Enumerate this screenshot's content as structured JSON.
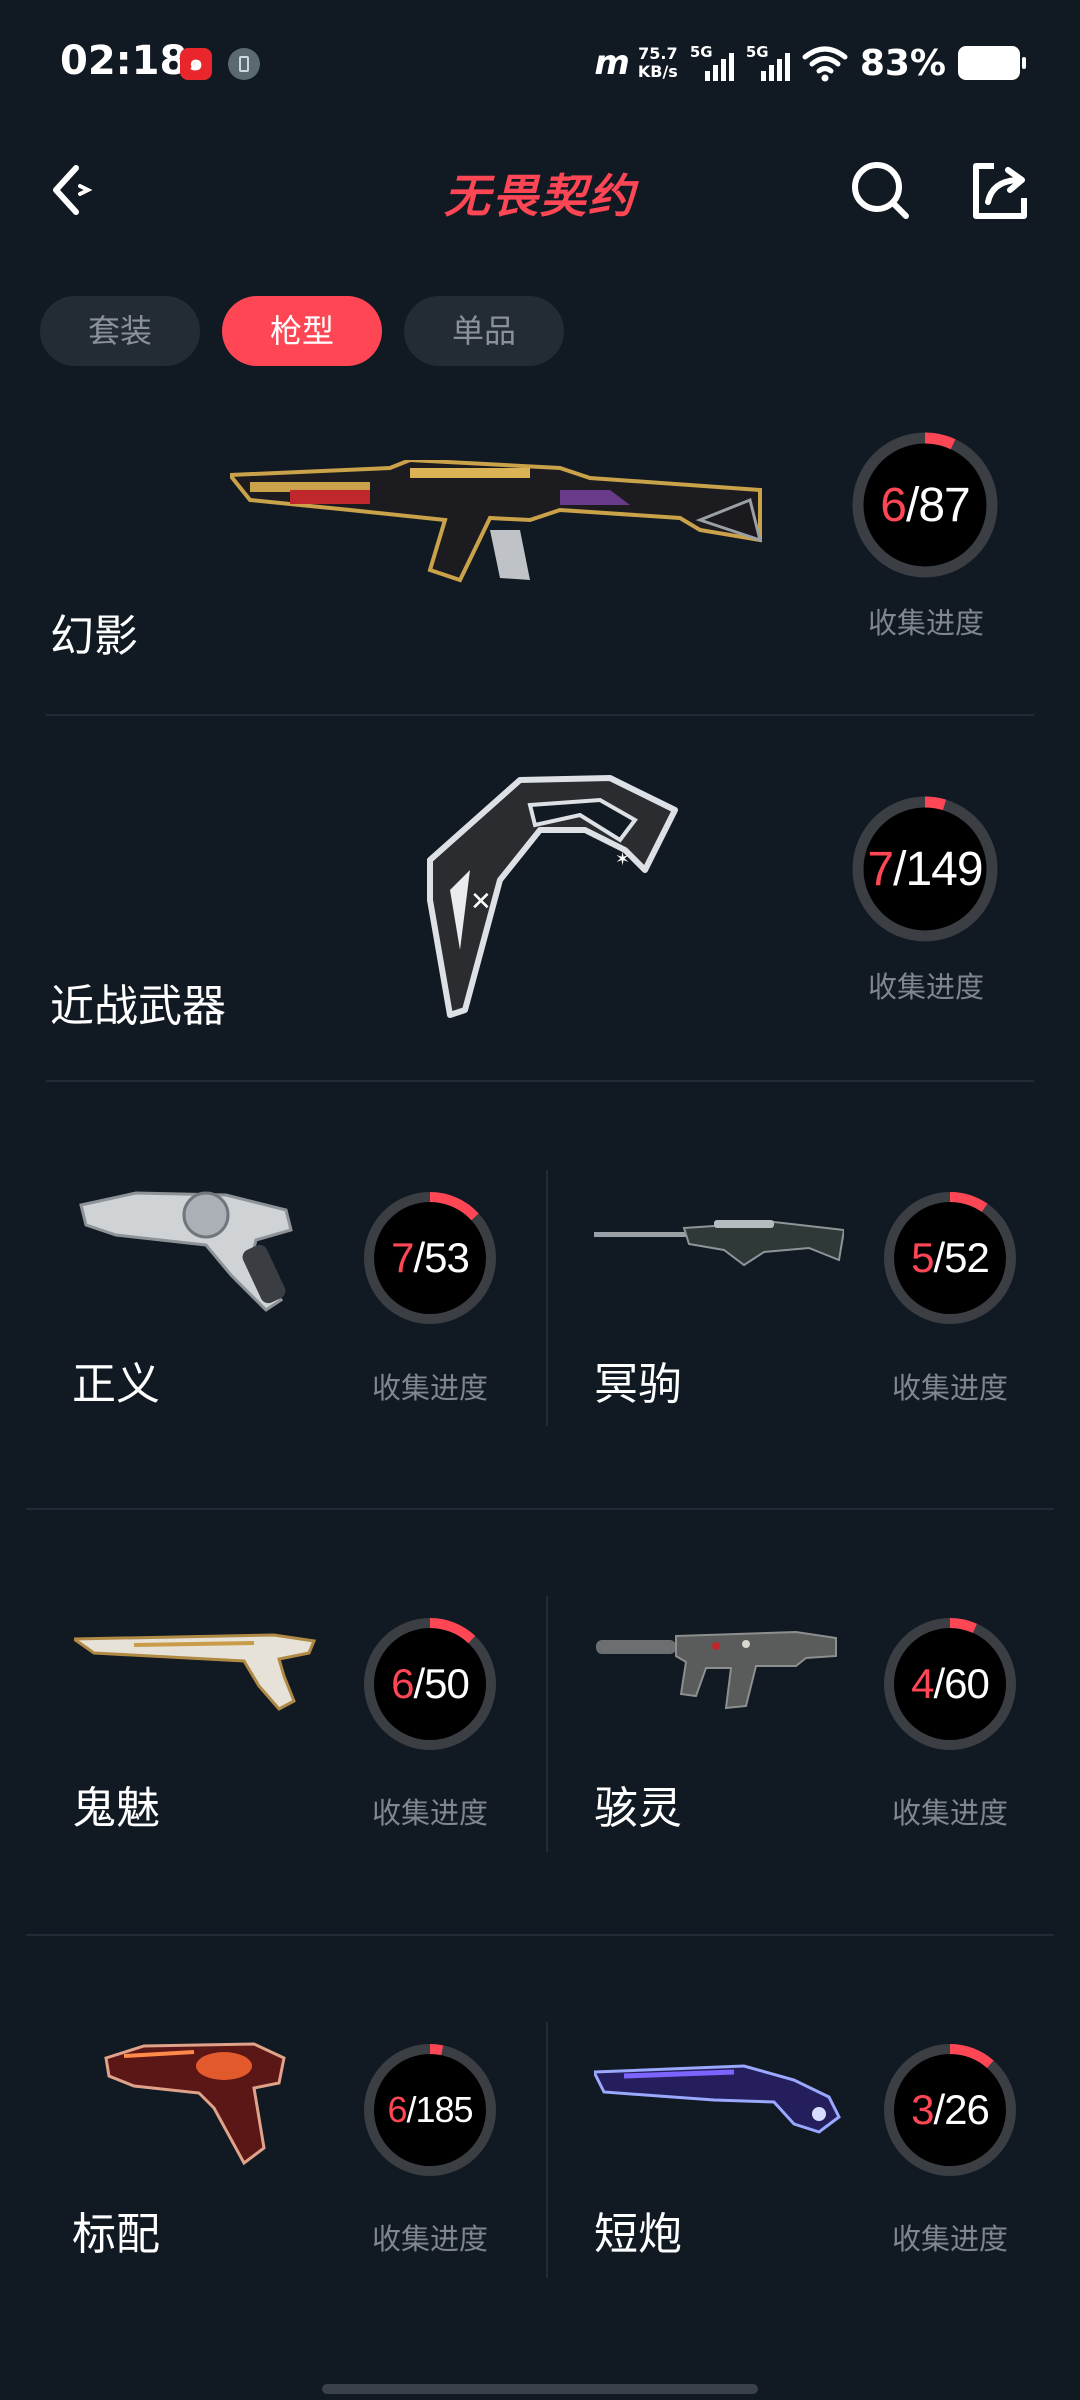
{
  "status_bar": {
    "time": "02:18",
    "carrier_logo": "m",
    "net_speed_value": "75.7",
    "net_speed_unit": "KB/s",
    "sim1": "5G",
    "sim2": "5G",
    "battery": "83%"
  },
  "header": {
    "title": "无畏契约",
    "back_icon": "chevron-left-icon",
    "search_icon": "search-icon",
    "share_icon": "share-icon"
  },
  "tabs": [
    {
      "label": "套装",
      "active": false
    },
    {
      "label": "枪型",
      "active": true
    },
    {
      "label": "单品",
      "active": false
    }
  ],
  "progress_label": "收集进度",
  "accent_color": "#ff4655",
  "items": [
    {
      "name": "幻影",
      "collected": "6",
      "total": "87",
      "progress": 0.069
    },
    {
      "name": "近战武器",
      "collected": "7",
      "total": "149",
      "progress": 0.047
    },
    {
      "name": "正义",
      "collected": "7",
      "total": "53",
      "progress": 0.132
    },
    {
      "name": "冥驹",
      "collected": "5",
      "total": "52",
      "progress": 0.096
    },
    {
      "name": "鬼魅",
      "collected": "6",
      "total": "50",
      "progress": 0.12
    },
    {
      "name": "骇灵",
      "collected": "4",
      "total": "60",
      "progress": 0.067
    },
    {
      "name": "标配",
      "collected": "6",
      "total": "185",
      "progress": 0.032
    },
    {
      "name": "短炮",
      "collected": "3",
      "total": "26",
      "progress": 0.115
    }
  ]
}
